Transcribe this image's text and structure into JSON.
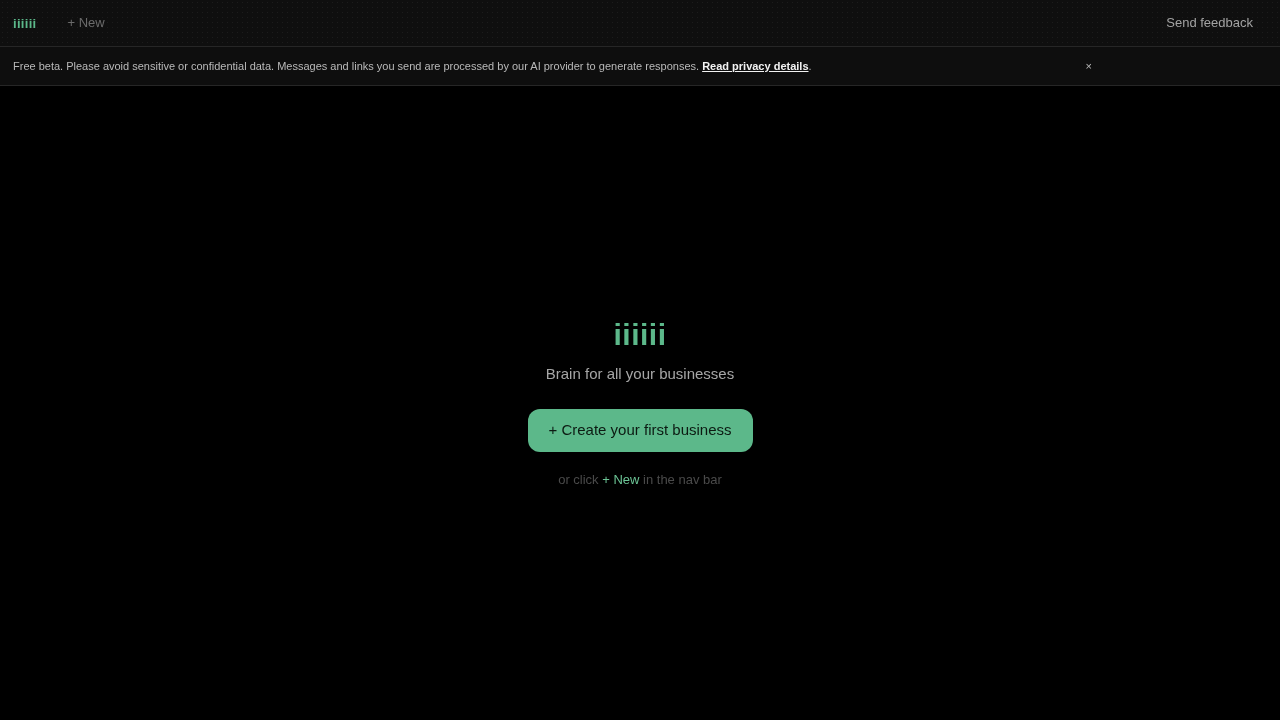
{
  "navbar": {
    "logo": "iiiiii",
    "new_button": "+ New",
    "feedback_link": "Send feedback"
  },
  "notice": {
    "text": "Free beta. Please avoid sensitive or confidential data. Messages and links you send are processed by our AI provider to generate responses.",
    "link": "Read privacy details",
    "after": ".",
    "close": "×"
  },
  "empty_state": {
    "logo": "iiiiii",
    "tagline": "Brain for all your businesses",
    "button": "+ Create your first business",
    "hint": "or click **+ New** in the nav bar"
  }
}
